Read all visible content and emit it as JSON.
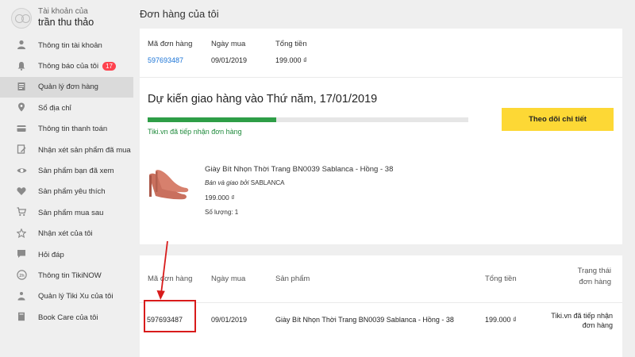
{
  "user": {
    "caption": "Tài khoản của",
    "name": "trần thu thảo"
  },
  "sidebar": {
    "items": [
      {
        "label": "Thông tin tài khoản",
        "icon": "person-icon"
      },
      {
        "label": "Thông báo của tôi",
        "icon": "bell-icon",
        "badge": "17"
      },
      {
        "label": "Quản lý đơn hàng",
        "icon": "orders-icon",
        "active": true
      },
      {
        "label": "Sổ địa chỉ",
        "icon": "location-icon"
      },
      {
        "label": "Thông tin thanh toán",
        "icon": "credit-card-icon"
      },
      {
        "label": "Nhận xét sản phẩm đã mua",
        "icon": "review-icon"
      },
      {
        "label": "Sản phẩm bạn đã xem",
        "icon": "eye-icon"
      },
      {
        "label": "Sản phẩm yêu thích",
        "icon": "heart-icon"
      },
      {
        "label": "Sản phẩm mua sau",
        "icon": "cart-icon"
      },
      {
        "label": "Nhận xét của tôi",
        "icon": "star-icon"
      },
      {
        "label": "Hỏi đáp",
        "icon": "chat-icon"
      },
      {
        "label": "Thông tin TikiNOW",
        "icon": "tikinow-icon"
      },
      {
        "label": "Quản lý Tiki Xu của tôi",
        "icon": "coin-icon"
      },
      {
        "label": "Book Care của tôi",
        "icon": "book-icon"
      }
    ]
  },
  "page": {
    "title": "Đơn hàng của tôi"
  },
  "summary": {
    "order_id_label": "Mã đơn hàng",
    "date_label": "Ngày mua",
    "total_label": "Tổng tiền",
    "order_id": "597693487",
    "date": "09/01/2019",
    "total": "199.000 ₫"
  },
  "delivery": {
    "title": "Dự kiến giao hàng vào Thứ năm, 17/01/2019",
    "progress_fraction": 0.4,
    "status_note": "Tiki.vn đã tiếp nhận đơn hàng",
    "track_button": "Theo dõi chi tiết"
  },
  "product": {
    "name": "Giày Bít Nhọn Thời Trang BN0039 Sablanca - Hồng - 38",
    "seller_prefix": "Bán và giao bởi",
    "seller": "SABLANCA",
    "price": "199.000 ₫",
    "quantity": "Số lượng: 1"
  },
  "table": {
    "headers": {
      "order_id": "Mã đơn hàng",
      "date": "Ngày mua",
      "product": "Sản phẩm",
      "total": "Tổng tiền",
      "status_line1": "Trạng thái",
      "status_line2": "đơn hàng"
    },
    "row": {
      "order_id": "597693487",
      "date": "09/01/2019",
      "product": "Giày Bít Nhọn Thời Trang BN0039 Sablanca - Hồng - 38",
      "total": "199.000 ₫",
      "status_line1": "Tiki.vn đã tiếp nhận",
      "status_line2": "đơn hàng"
    }
  },
  "colors": {
    "link": "#1a73d6",
    "accent_yellow": "#fdd835",
    "progress_green": "#2e9e47",
    "badge_red": "#ff424e",
    "highlight_red": "#d81b1b"
  }
}
